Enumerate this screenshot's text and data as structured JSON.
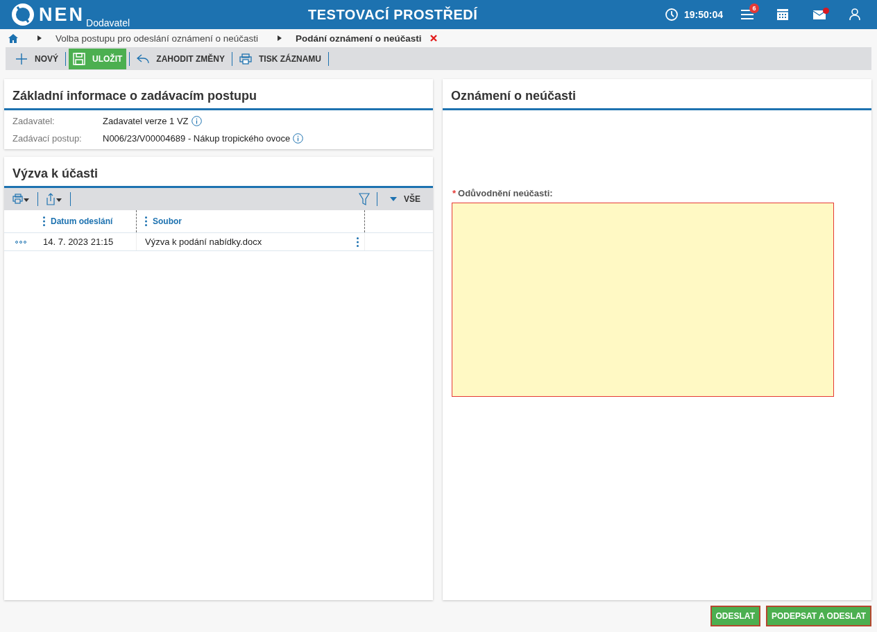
{
  "header": {
    "logo": "NEN",
    "logo_sub": "Dodavatel",
    "title": "TESTOVACÍ PROSTŘEDÍ",
    "time": "19:50:04",
    "notifications": "6",
    "mail_unread": true
  },
  "breadcrumb": [
    {
      "label": "Volba postupu pro odeslání oznámení o neúčasti",
      "current": false
    },
    {
      "label": "Podání oznámení o neúčasti",
      "current": true
    }
  ],
  "toolbar": [
    {
      "kind": "new",
      "label": "NOVÝ",
      "primary": false
    },
    {
      "kind": "save",
      "label": "ULOŽIT",
      "primary": true
    },
    {
      "kind": "discard",
      "label": "ZAHODIT ZMĚNY",
      "primary": false
    },
    {
      "kind": "print",
      "label": "TISK ZÁZNAMU",
      "primary": false
    }
  ],
  "info": {
    "title": "Základní informace o zadávacím postupu",
    "fields": [
      {
        "label": "Zadavatel:",
        "value": "Zadavatel verze 1 VZ"
      },
      {
        "label": "Zadávací postup:",
        "value": "N006/23/V00004689 - Nákup tropického ovoce"
      }
    ]
  },
  "invitation": {
    "title": "Výzva k účasti",
    "filter_label": "VŠE",
    "columns": [
      "Datum odeslání",
      "Soubor"
    ],
    "rows": [
      {
        "cells": [
          "14. 7. 2023 21:15",
          "Výzva k podání nabídky.docx"
        ]
      }
    ]
  },
  "notice": {
    "title": "Oznámení o neúčasti",
    "field": {
      "label": "Odůvodnění neúčasti:",
      "required_mark": "*",
      "invalid": true
    }
  },
  "buttons": [
    {
      "label": "ODESLAT"
    },
    {
      "label": "PODEPSAT A ODESLAT"
    }
  ]
}
